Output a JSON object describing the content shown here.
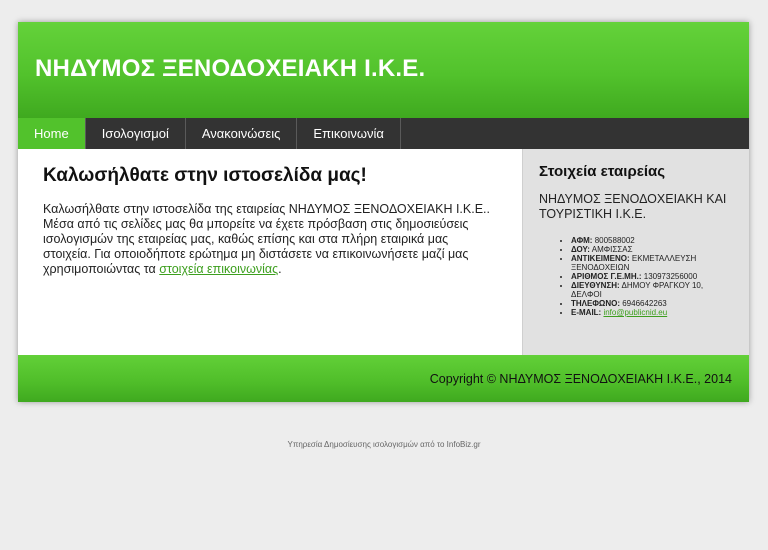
{
  "header": {
    "site_title": "ΝΗΔΥΜΟΣ ΞΕΝΟΔΟΧΕΙΑΚΗ Ι.Κ.Ε."
  },
  "nav": {
    "items": [
      {
        "label": "Home",
        "active": true
      },
      {
        "label": "Ισολογισμοί",
        "active": false
      },
      {
        "label": "Ανακοινώσεις",
        "active": false
      },
      {
        "label": "Επικοινωνία",
        "active": false
      }
    ]
  },
  "main": {
    "heading": "Καλωσήλθατε στην ιστοσελίδα μας!",
    "intro_text": "Καλωσήλθατε στην ιστοσελίδα της εταιρείας ΝΗΔΥΜΟΣ ΞΕΝΟΔΟΧΕΙΑΚΗ Ι.Κ.Ε.. Μέσα από τις σελίδες μας θα μπορείτε να έχετε πρόσβαση στις δημοσιεύσεις ισολογισμών της εταιρείας μας, καθώς επίσης και στα πλήρη εταιρικά μας στοιχεία. Για οποιοδήποτε ερώτημα μη διστάσετε να επικοινωνήσετε μαζί μας χρησιμοποιώντας τα ",
    "contact_link": "στοιχεία επικοινωνίας",
    "intro_end": "."
  },
  "sidebar": {
    "heading": "Στοιχεία εταιρείας",
    "company_full_name": "ΝΗΔΥΜΟΣ ΞΕΝΟΔΟΧΕΙΑΚΗ ΚΑΙ ΤΟΥΡΙΣΤΙΚΗ Ι.Κ.Ε.",
    "info": [
      {
        "label": "ΑΦΜ:",
        "value": "800588002"
      },
      {
        "label": "ΔΟΥ:",
        "value": "ΑΜΦΙΣΣΑΣ"
      },
      {
        "label": "ΑΝΤΙΚΕΙΜΕΝΟ:",
        "value": "ΕΚΜΕΤΑΛΛΕΥΣΗ ΞΕΝΟΔΟΧΕΙΩΝ"
      },
      {
        "label": "ΑΡΙΘΜΟΣ Γ.Ε.ΜΗ.:",
        "value": "130973256000"
      },
      {
        "label": "ΔΙΕΥΘΥΝΣΗ:",
        "value": "ΔΗΜΟΥ ΦΡΑΓΚΟΥ 10, ΔΕΛΦΟΙ"
      },
      {
        "label": "ΤΗΛΕΦΩΝΟ:",
        "value": "6946642263"
      }
    ],
    "email_label": "E-MAIL:",
    "email_value": "info@publicnid.eu"
  },
  "footer": {
    "copyright": "Copyright © ΝΗΔΥΜΟΣ ΞΕΝΟΔΟΧΕΙΑΚΗ Ι.Κ.Ε., 2014"
  },
  "credit": "Υπηρεσία Δημοσίευσης ισολογισμών από το InfoBiz.gr",
  "colors": {
    "accent_green": "#52c22c",
    "nav_dark": "#333333",
    "sidebar_bg": "#e1e1e1",
    "link_green": "#3d9f1e"
  }
}
